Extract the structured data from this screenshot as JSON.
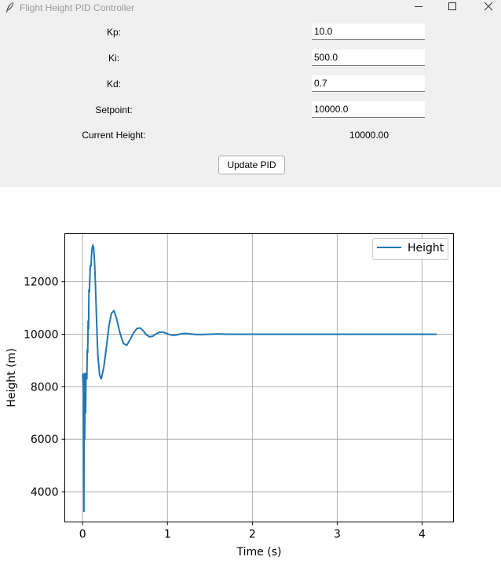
{
  "window": {
    "title": "Flight Height PID Controller",
    "icon": "feather-icon",
    "controls": [
      "minimize-icon",
      "maximize-icon",
      "close-icon"
    ]
  },
  "form": {
    "kp": {
      "label": "Kp:",
      "value": "10.0"
    },
    "ki": {
      "label": "Ki:",
      "value": "500.0"
    },
    "kd": {
      "label": "Kd:",
      "value": "0.7"
    },
    "setpoint": {
      "label": "Setpoint:",
      "value": "10000.0"
    },
    "current_height": {
      "label": "Current Height:",
      "value": "10000.00"
    },
    "update_button": "Update PID"
  },
  "chart_data": {
    "type": "line",
    "title": "",
    "xlabel": "Time (s)",
    "ylabel": "Height (m)",
    "xlim": [
      -0.21,
      4.37
    ],
    "ylim": [
      2850,
      13830
    ],
    "xticks": [
      0,
      1,
      2,
      3,
      4
    ],
    "yticks": [
      4000,
      6000,
      8000,
      10000,
      12000
    ],
    "xtick_labels": [
      "0",
      "1",
      "2",
      "3",
      "4"
    ],
    "ytick_labels": [
      "4000",
      "6000",
      "8000",
      "10000",
      "12000"
    ],
    "grid": true,
    "legend_position": "upper right",
    "line_color": "#1f77b4",
    "series": [
      {
        "name": "Height",
        "x": [
          0.0,
          0.01,
          0.015,
          0.02,
          0.025,
          0.03,
          0.035,
          0.04,
          0.045,
          0.05,
          0.055,
          0.06,
          0.065,
          0.07,
          0.075,
          0.08,
          0.09,
          0.1,
          0.105,
          0.11,
          0.115,
          0.12,
          0.13,
          0.14,
          0.15,
          0.16,
          0.17,
          0.18,
          0.2,
          0.22,
          0.25,
          0.28,
          0.31,
          0.34,
          0.37,
          0.4,
          0.44,
          0.48,
          0.52,
          0.56,
          0.6,
          0.64,
          0.68,
          0.71,
          0.75,
          0.79,
          0.83,
          0.87,
          0.91,
          0.95,
          0.99,
          1.03,
          1.07,
          1.1,
          1.15,
          1.2,
          1.25,
          1.3,
          1.35,
          1.4,
          1.5,
          1.6,
          1.7,
          1.8,
          1.9,
          2.0,
          2.2,
          2.5,
          3.0,
          3.5,
          4.0,
          4.17
        ],
        "y": [
          8500,
          7900,
          3250,
          8500,
          6000,
          8500,
          7000,
          8400,
          8500,
          8300,
          9400,
          9300,
          10500,
          10200,
          11700,
          11600,
          12600,
          12600,
          13000,
          13200,
          13300,
          13400,
          13300,
          12800,
          12000,
          11000,
          10000,
          9200,
          8450,
          8300,
          8750,
          9500,
          10300,
          10800,
          10900,
          10600,
          10050,
          9650,
          9580,
          9800,
          10050,
          10220,
          10240,
          10150,
          9980,
          9900,
          9930,
          10020,
          10080,
          10080,
          10030,
          9980,
          9960,
          9970,
          10010,
          10030,
          10020,
          10000,
          9990,
          9990,
          10000,
          10010,
          10000,
          10000,
          10000,
          10000,
          10000,
          10000,
          10000,
          10000,
          10000,
          10000
        ]
      }
    ]
  }
}
